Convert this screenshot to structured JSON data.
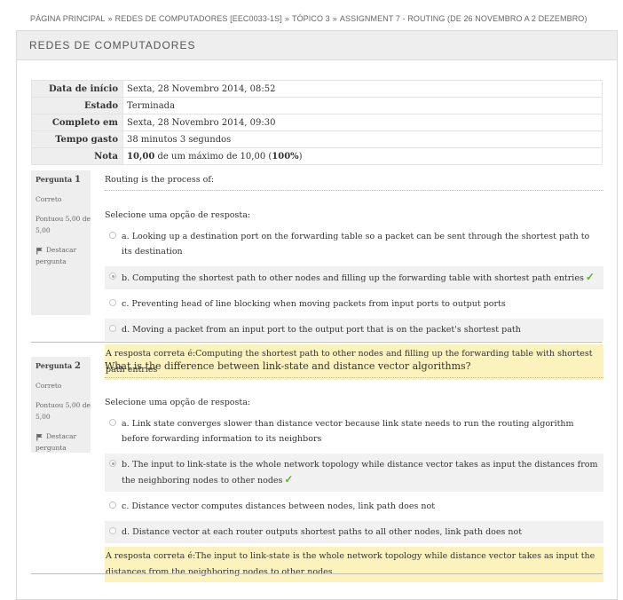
{
  "breadcrumb": {
    "items": [
      "PÁGINA PRINCIPAL",
      "REDES DE COMPUTADORES [EEC0033-1S]",
      "TÓPICO 3",
      "ASSIGNMENT 7 - ROUTING (DE 26 NOVEMBRO A 2 DEZEMBRO)"
    ],
    "separator": "»"
  },
  "panel": {
    "title": "REDES DE COMPUTADORES"
  },
  "summary": [
    {
      "label": "Data de início",
      "value": "Sexta, 28 Novembro 2014, 08:52"
    },
    {
      "label": "Estado",
      "value": "Terminada"
    },
    {
      "label": "Completo em",
      "value": "Sexta, 28 Novembro 2014, 09:30"
    },
    {
      "label": "Tempo gasto",
      "value": "38 minutos 3 segundos"
    },
    {
      "label": "Nota",
      "value_bold": "10,00",
      "value_mid": " de um máximo de 10,00 (",
      "value_pct": "100%",
      "value_end": ")"
    }
  ],
  "questions": [
    {
      "label": "Pergunta",
      "number": "1",
      "state": "Correto",
      "marks": "Pontuou 5,00 de 5,00",
      "flag_label": "Destacar pergunta",
      "text": "Routing is the process of:",
      "prompt": "Selecione uma opção de resposta:",
      "options": [
        "a. Looking up a destination port on the forwarding table so a packet can be sent through the shortest path to its destination",
        "b. Computing the shortest path to other nodes and filling up the forwarding table with shortest path entries",
        "c. Preventing head of line blocking when moving packets from input ports to output ports",
        "d. Moving a packet from an input port to the output port that is on the packet's shortest path"
      ],
      "feedback": "A resposta correta é:Computing the shortest path to other nodes and filling up the forwarding table with shortest path entries"
    },
    {
      "label": "Pergunta",
      "number": "2",
      "state": "Correto",
      "marks": "Pontuou 5,00 de 5,00",
      "flag_label": "Destacar pergunta",
      "text": "What is the difference between link-state and distance vector algorithms?",
      "prompt": "Selecione uma opção de resposta:",
      "options": [
        "a. Link state converges slower than distance vector because link state needs to run the routing algorithm before forwarding information to its neighbors",
        "b. The input to link-state is the whole network topology while distance vector takes as input the distances from the neighboring nodes to other nodes",
        "c. Distance vector computes distances between nodes, link path does not",
        "d. Distance vector at each router outputs shortest paths to all other nodes, link path does not"
      ],
      "feedback": "A resposta correta é:The input to link-state is the whole network topology while distance vector takes as input the distances from the neighboring nodes to other nodes"
    }
  ],
  "colors": {
    "feedback_bg": "#fcf2bb",
    "tick": "#5fb02c",
    "header_bg": "#eeeeee"
  },
  "icons": {
    "correct": "check-icon",
    "flag": "flag-icon"
  }
}
